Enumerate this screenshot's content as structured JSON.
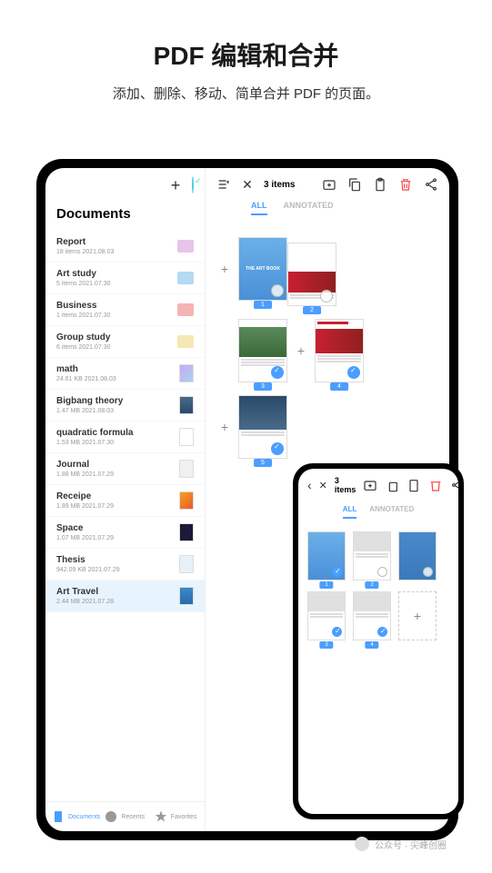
{
  "hero": {
    "title": "PDF 编辑和合并",
    "subtitle": "添加、删除、移动、简单合并 PDF 的页面。"
  },
  "sidebar": {
    "heading": "Documents",
    "items": [
      {
        "name": "Report",
        "meta": "18 items   2021.08.03",
        "color": "#e8c4e8",
        "type": "folder"
      },
      {
        "name": "Art study",
        "meta": "5 items   2021.07.30",
        "color": "#b4d9f4",
        "type": "folder"
      },
      {
        "name": "Business",
        "meta": "1 items   2021.07.30",
        "color": "#f4b4b4",
        "type": "folder"
      },
      {
        "name": "Group study",
        "meta": "6 items   2021.07.30",
        "color": "#f4e8b4",
        "type": "folder"
      },
      {
        "name": "math",
        "meta": "24.61 KB   2021.08.03",
        "thumbBg": "linear-gradient(135deg,#c8a8f0,#a8d4f0)",
        "type": "file"
      },
      {
        "name": "Bigbang theory",
        "meta": "1.47 MB   2021.08.03",
        "thumbBg": "linear-gradient(180deg,#4a6a8a,#2a4a6a)",
        "type": "file"
      },
      {
        "name": "quadratic formula",
        "meta": "1.53 MB   2021.07.30",
        "thumbBg": "#fff",
        "type": "file"
      },
      {
        "name": "Journal",
        "meta": "1.88 MB   2021.07.29",
        "thumbBg": "#f0f0f0",
        "type": "file"
      },
      {
        "name": "Receipe",
        "meta": "1.89 MB   2021.07.29",
        "thumbBg": "linear-gradient(135deg,#f4a020,#e85a2a)",
        "type": "file"
      },
      {
        "name": "Space",
        "meta": "1.07 MB   2021.07.29",
        "thumbBg": "#1a1a3a",
        "type": "file"
      },
      {
        "name": "Thesis",
        "meta": "942.09 KB   2021.07.29",
        "thumbBg": "#e8f0f8",
        "type": "file"
      },
      {
        "name": "Art Travel",
        "meta": "2.44 MB   2021.07.28",
        "thumbBg": "linear-gradient(180deg,#3a8acc,#2a6aaa)",
        "type": "file",
        "selected": true
      }
    ],
    "tabs": {
      "documents": "Documents",
      "recents": "Recents",
      "favorites": "Favorites"
    }
  },
  "editor": {
    "selection_count": "3 items",
    "filters": {
      "all": "ALL",
      "annotated": "ANNOTATED"
    },
    "pages": [
      {
        "label": "1",
        "title": "THE ART BOOK",
        "selected": false,
        "bg": "linear-gradient(180deg,#6ab0e8,#4a90d8)"
      },
      {
        "label": "2",
        "title": "",
        "selected": false,
        "bg": "#fff",
        "car": true
      },
      {
        "label": "3",
        "title": "",
        "selected": true,
        "bg": "#fff",
        "landscape": true
      },
      {
        "label": "4",
        "title": "",
        "selected": true,
        "bg": "#fff",
        "car": true,
        "redtext": true
      },
      {
        "label": "5",
        "title": "",
        "selected": true,
        "bg": "#fff",
        "coast": true
      }
    ]
  },
  "phone": {
    "selection_count": "3 items",
    "filters": {
      "all": "ALL",
      "annotated": "ANNOTATED"
    },
    "pages": [
      {
        "label": "1",
        "selected": true,
        "bg": "linear-gradient(180deg,#6ab0e8,#4a90d8)"
      },
      {
        "label": "2",
        "selected": false,
        "bg": "#fff"
      },
      {
        "label": "3",
        "selected": true,
        "bg": "#fff"
      },
      {
        "label": "4",
        "selected": true,
        "bg": "#fff"
      }
    ]
  },
  "attribution": "公众号 · 尖峰创圈"
}
